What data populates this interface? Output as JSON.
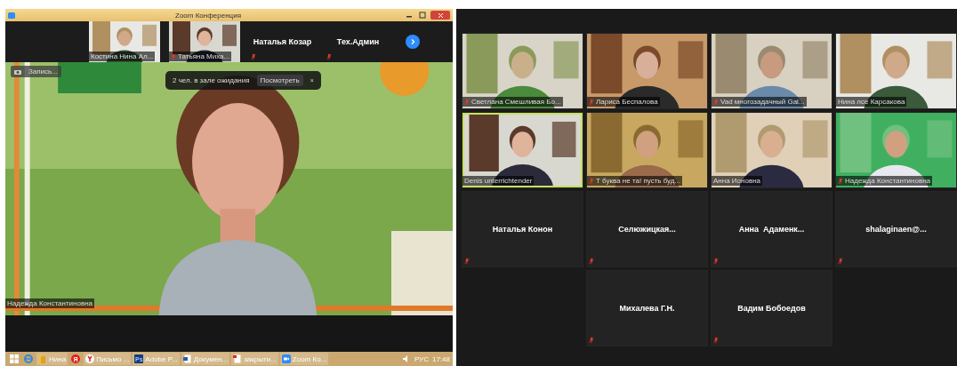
{
  "zoom_window": {
    "title": "Zoom Конференция",
    "strip": [
      {
        "kind": "video",
        "name": "Костина Нина Ал...",
        "muted": false
      },
      {
        "kind": "video",
        "name": "Татьяна Миха...",
        "muted": true
      },
      {
        "kind": "name",
        "name": "Наталья Козар",
        "muted": true
      },
      {
        "kind": "name",
        "name": "Тех.Админ",
        "muted": true
      }
    ],
    "record_button": "Запись...",
    "waiting_room": {
      "text": "2 чел. в зале ожидания",
      "button": "Посмотреть",
      "close": "×"
    },
    "speaker_name": "Надежда Константиновна"
  },
  "taskbar": {
    "items": [
      {
        "kind": "windows"
      },
      {
        "kind": "ie"
      },
      {
        "kind": "folder",
        "label": "Нина"
      },
      {
        "kind": "yandex",
        "glyph": "Я"
      },
      {
        "kind": "ybrowser",
        "label": "Письмо ..."
      },
      {
        "kind": "ps",
        "glyph": "Ps",
        "label": "Adobe P..."
      },
      {
        "kind": "doc",
        "label": "Докумен..."
      },
      {
        "kind": "pdf",
        "label": "закрыти..."
      },
      {
        "kind": "zoom",
        "label": "Zoom Ко..."
      }
    ],
    "language": "РУС",
    "time": "17:48"
  },
  "gallery": {
    "rows": [
      [
        {
          "kind": "video",
          "name": "Светлана Смешливая Бо...",
          "muted": true,
          "speaking": false
        },
        {
          "kind": "video",
          "name": "Лариса Беспалова",
          "muted": true,
          "speaking": false
        },
        {
          "kind": "video",
          "name": "Vad многозадачный Gal...",
          "muted": true,
          "speaking": false
        },
        {
          "kind": "video",
          "name": "Нина лсе Карсакова",
          "muted": false,
          "speaking": false
        }
      ],
      [
        {
          "kind": "video",
          "name": "Denis unterrichtender",
          "muted": false,
          "speaking": true
        },
        {
          "kind": "video",
          "name": "Т буква не та! пусть буд...",
          "muted": true,
          "speaking": false
        },
        {
          "kind": "video",
          "name": "Анна Ионовна",
          "muted": false,
          "speaking": false
        },
        {
          "kind": "video",
          "name": "Надежда Константиновна",
          "muted": true,
          "speaking": false
        }
      ],
      [
        {
          "kind": "name",
          "name": "Наталья Конон",
          "muted": true,
          "speaking": false
        },
        {
          "kind": "name",
          "name": "Селюжицкая...",
          "muted": true,
          "speaking": false
        },
        {
          "kind": "name",
          "name": "Анна  Адаменк...",
          "muted": true,
          "speaking": false
        },
        {
          "kind": "name",
          "name": "shalaginaen@...",
          "muted": true,
          "speaking": false
        }
      ],
      [
        "",
        {
          "kind": "name",
          "name": "Михалева Г.Н.",
          "muted": true,
          "speaking": false
        },
        {
          "kind": "name",
          "name": "Вадим Бобоедов",
          "muted": true,
          "speaking": false
        },
        ""
      ]
    ]
  }
}
